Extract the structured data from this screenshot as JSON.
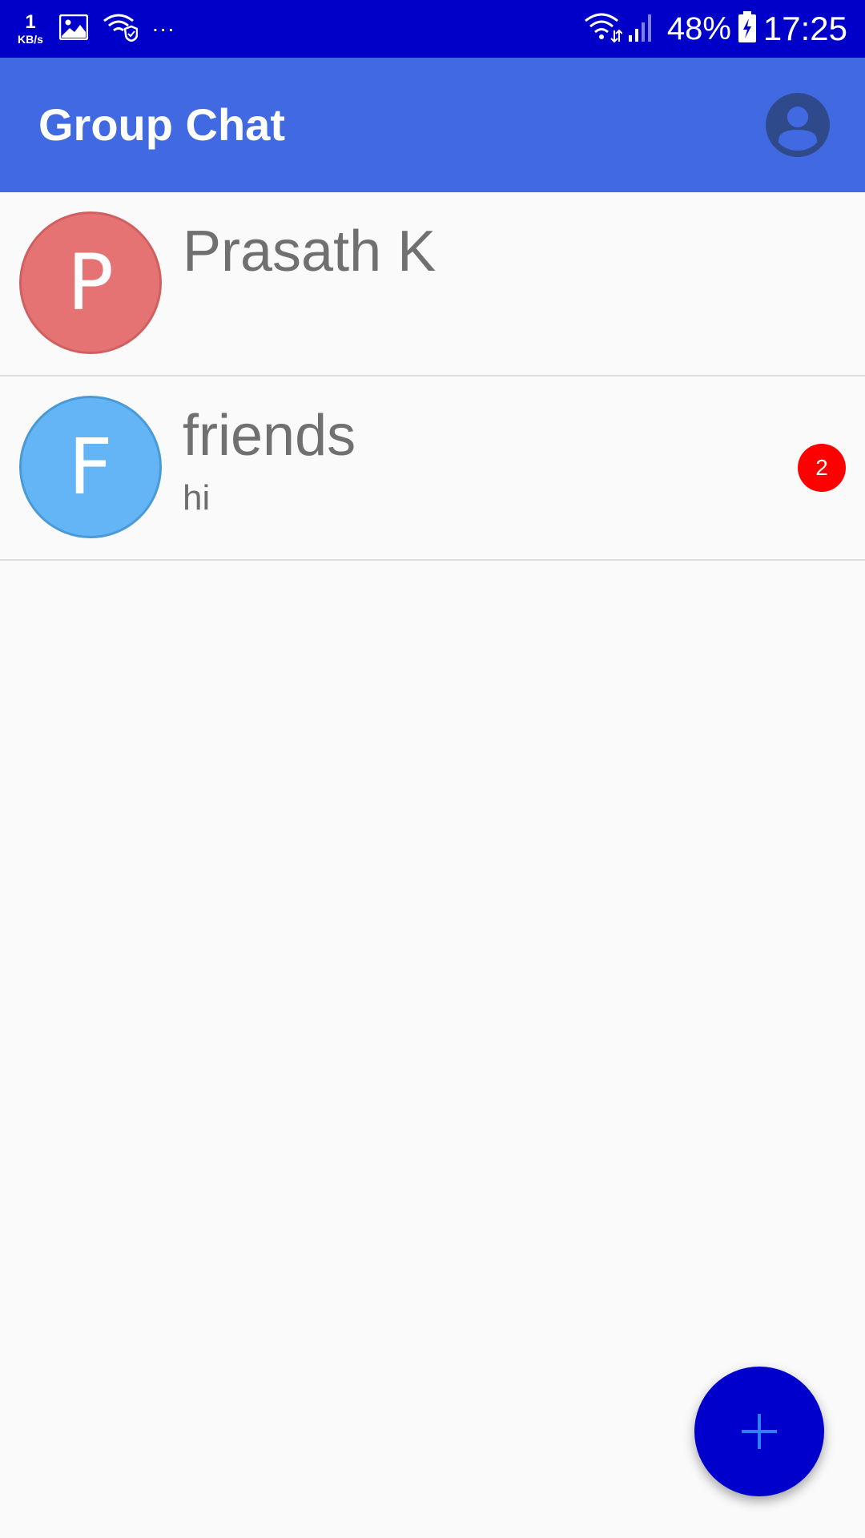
{
  "status_bar": {
    "net_speed_value": "1",
    "net_speed_unit": "KB/s",
    "more_indicator": "...",
    "battery_percent": "48%",
    "time": "17:25",
    "icons": [
      "gallery-icon",
      "wifi-shield-icon",
      "wifi-icon",
      "signal-icon",
      "battery-charging-icon"
    ]
  },
  "app_bar": {
    "title": "Group Chat",
    "account_icon": "account-circle-icon",
    "background": "#4169e1"
  },
  "chats": [
    {
      "initial": "P",
      "name": "Prasath K",
      "last_message": "",
      "avatar_color": "#e57373",
      "unread": null
    },
    {
      "initial": "F",
      "name": "friends",
      "last_message": "hi",
      "avatar_color": "#64b5f6",
      "unread": "2"
    }
  ],
  "fab": {
    "icon": "plus-icon",
    "color": "#0000cd"
  }
}
